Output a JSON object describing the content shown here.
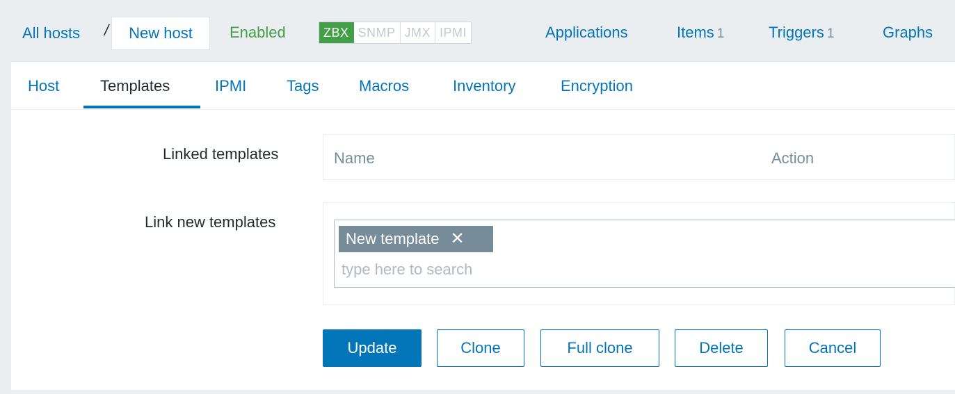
{
  "breadcrumb": {
    "all_hosts": "All hosts",
    "separator": "/",
    "current": "New host"
  },
  "host_status": "Enabled",
  "availability": [
    {
      "label": "ZBX",
      "active": true
    },
    {
      "label": "SNMP",
      "active": false
    },
    {
      "label": "JMX",
      "active": false
    },
    {
      "label": "IPMI",
      "active": false
    }
  ],
  "host_nav": {
    "applications": {
      "label": "Applications"
    },
    "items": {
      "label": "Items",
      "count": "1"
    },
    "triggers": {
      "label": "Triggers",
      "count": "1"
    },
    "graphs": {
      "label": "Graphs"
    }
  },
  "tabs": [
    {
      "label": "Host",
      "active": false
    },
    {
      "label": "Templates",
      "active": true
    },
    {
      "label": "IPMI",
      "active": false
    },
    {
      "label": "Tags",
      "active": false
    },
    {
      "label": "Macros",
      "active": false
    },
    {
      "label": "Inventory",
      "active": false
    },
    {
      "label": "Encryption",
      "active": false
    }
  ],
  "linked_templates": {
    "label": "Linked templates",
    "columns": [
      "Name",
      "Action"
    ]
  },
  "link_new_templates": {
    "label": "Link new templates",
    "selected": "New template",
    "placeholder": "type here to search"
  },
  "buttons": {
    "update": "Update",
    "clone": "Clone",
    "full_clone": "Full clone",
    "delete": "Delete",
    "cancel": "Cancel"
  },
  "colors": {
    "link": "#0275b8",
    "enabled": "#429e47",
    "chip": "#768d99",
    "background": "#ebeef0"
  }
}
